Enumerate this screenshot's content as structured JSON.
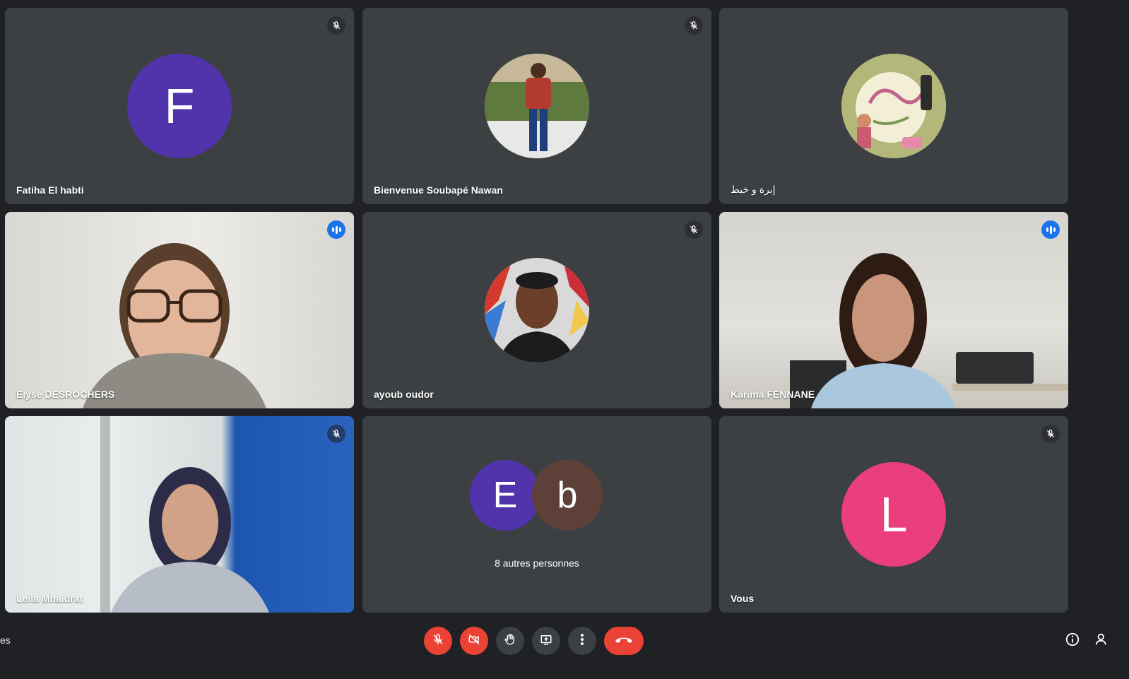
{
  "participants": [
    {
      "name": "Fatiha El habti",
      "initial": "F",
      "color": "#5133ab",
      "muted": true
    },
    {
      "name": "Bienvenue Soubapé Nawan",
      "muted": true
    },
    {
      "name": "إبرة و خيط",
      "muted": true
    },
    {
      "name": "Elyse DESROCHERS",
      "speaking": true
    },
    {
      "name": "ayoub oudor",
      "muted": true
    },
    {
      "name": "Karima FENNANE",
      "speaking": true
    },
    {
      "name": "Leila Mhaidrat",
      "muted": true
    },
    {
      "name": "Vous",
      "initial": "L",
      "color": "#ea3f7c",
      "muted": true
    }
  ],
  "others_tile": {
    "label": "8 autres personnes",
    "avatars": [
      {
        "initial": "E",
        "color": "#5133ab"
      },
      {
        "initial": "b",
        "color": "#5d4037"
      }
    ]
  },
  "bottom_bar": {
    "meeting_name_fragment": "es"
  }
}
